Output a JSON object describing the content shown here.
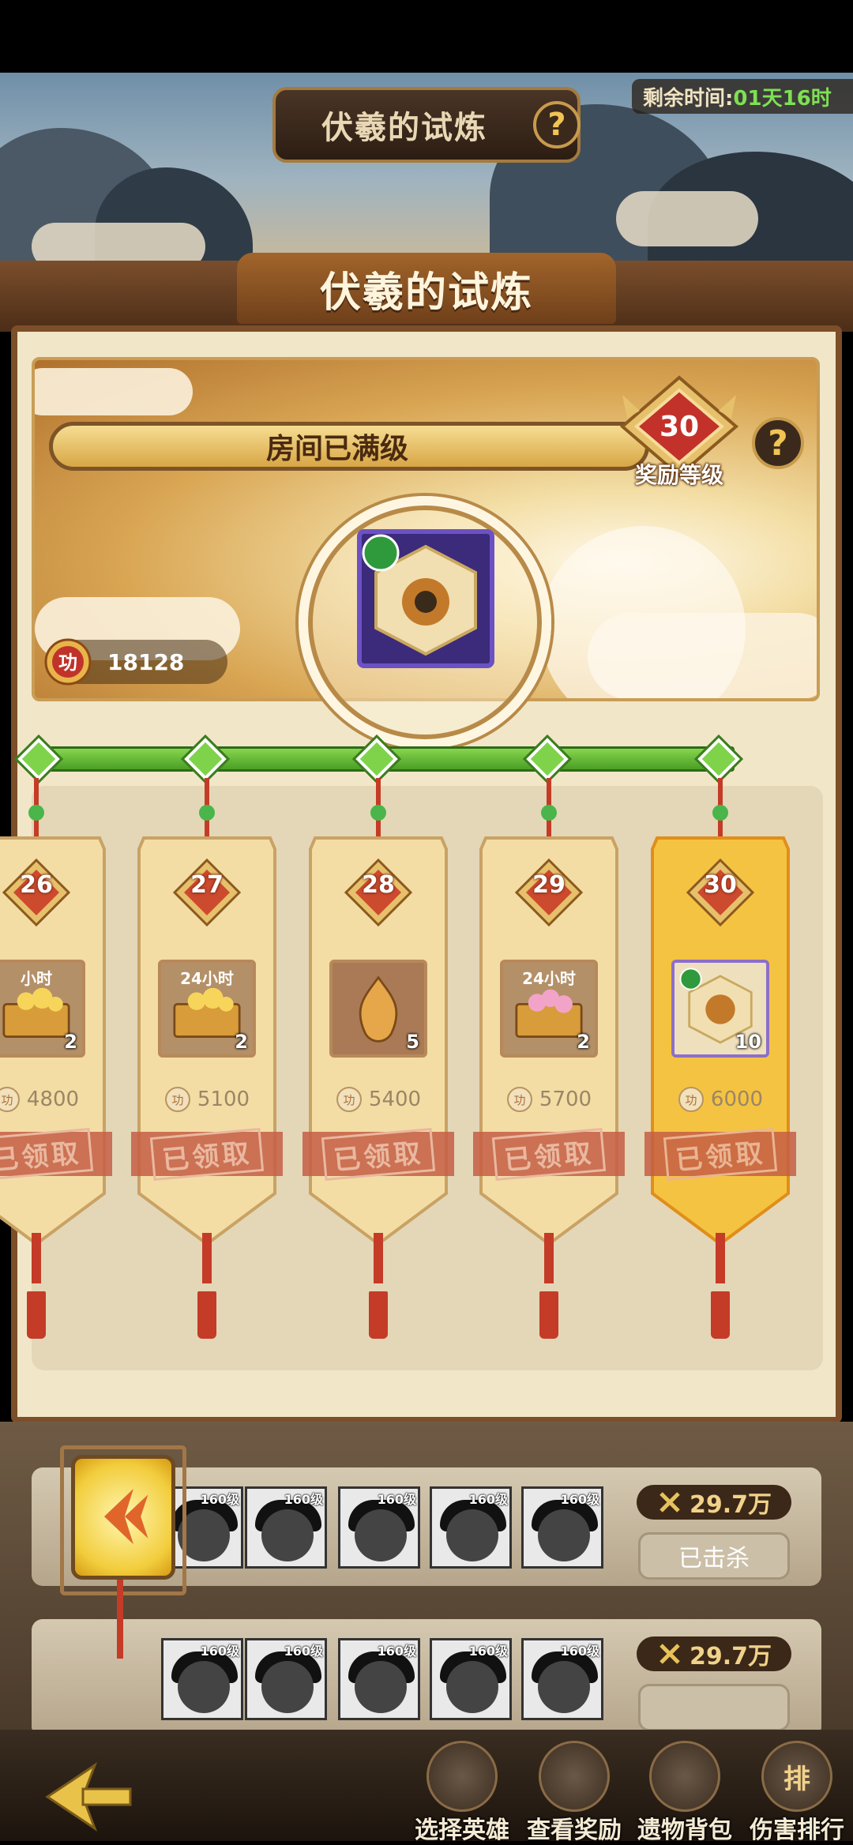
{
  "header": {
    "event_title": "伏羲的试炼",
    "timer_label": "剩余时间:",
    "timer_value": "01天16时"
  },
  "panel": {
    "title": "伏羲的试炼",
    "room_status": "房间已满级",
    "reward_level": "30",
    "reward_level_label": "奖励等级",
    "merit_glyph": "功",
    "merit_points": "18128"
  },
  "milestones": [
    {
      "level": "26",
      "tag": "小时",
      "qty": "2",
      "cost": "4800",
      "status": "已领取",
      "item": "gold-chest"
    },
    {
      "level": "27",
      "tag": "24小时",
      "qty": "2",
      "cost": "5100",
      "status": "已领取",
      "item": "gold-chest"
    },
    {
      "level": "28",
      "tag": "",
      "qty": "5",
      "cost": "5400",
      "status": "已领取",
      "item": "flame-emblem"
    },
    {
      "level": "29",
      "tag": "24小时",
      "qty": "2",
      "cost": "5700",
      "status": "已领取",
      "item": "pearl-chest"
    },
    {
      "level": "30",
      "tag": "",
      "qty": "10",
      "cost": "6000",
      "status": "已领取",
      "item": "relic-medal",
      "highlighted": true
    }
  ],
  "hero_rows": [
    {
      "power": "29.7万",
      "action": "已击杀",
      "heroes": [
        {
          "lv": "160级"
        },
        {
          "lv": "160级"
        },
        {
          "lv": "160级"
        },
        {
          "lv": "160级"
        },
        {
          "lv": "160级"
        }
      ]
    },
    {
      "power": "29.7万",
      "action": "",
      "heroes": [
        {
          "lv": "160级"
        },
        {
          "lv": "160级"
        },
        {
          "lv": "160级"
        },
        {
          "lv": "160级"
        },
        {
          "lv": "160级"
        }
      ]
    }
  ],
  "bottom_nav": [
    {
      "label": "选择英雄",
      "icon": "hero-icon"
    },
    {
      "label": "查看奖励",
      "icon": "chest-icon"
    },
    {
      "label": "遗物背包",
      "icon": "bag-icon"
    },
    {
      "label": "伤害排行",
      "icon": "ranking-icon",
      "glyph": "排"
    }
  ],
  "colors": {
    "timer_value": "#7ee053",
    "rail_green": "#6cc43d",
    "stamp_red": "#c65f45",
    "highlight_gold": "#f5c342"
  }
}
